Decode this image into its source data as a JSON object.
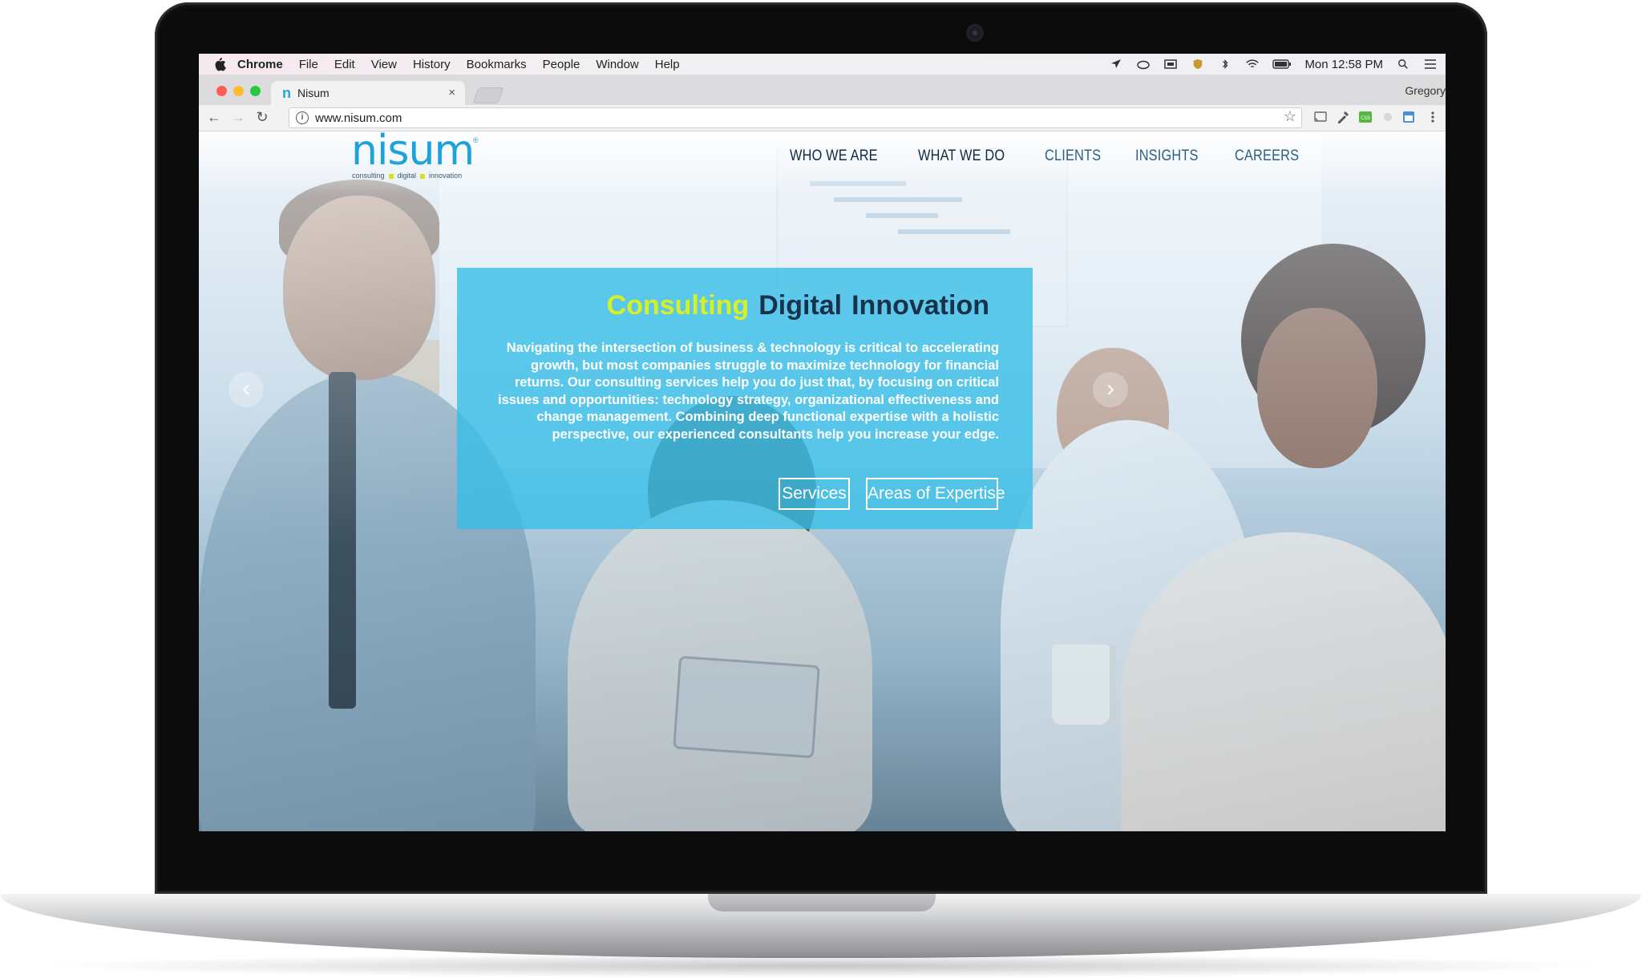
{
  "menubar": {
    "app": "Chrome",
    "items": [
      "File",
      "Edit",
      "View",
      "History",
      "Bookmarks",
      "People",
      "Window",
      "Help"
    ],
    "clock": "Mon 12:58 PM"
  },
  "browser": {
    "tab_title": "Nisum",
    "tab_favicon": "n",
    "tab_close": "×",
    "profile": "Gregory",
    "url": "www.nisum.com"
  },
  "site": {
    "logo_text": "nisum",
    "logo_reg": "®",
    "logo_tagline": [
      "consulting",
      "digital",
      "innovation"
    ],
    "nav": [
      "WHO WE ARE",
      "WHAT WE DO",
      "CLIENTS",
      "INSIGHTS",
      "CAREERS"
    ],
    "hero": {
      "title_1": "Consulting",
      "title_2": "Digital",
      "title_3": "Innovation",
      "body": "Navigating the intersection of business & technology is critical to accelerating growth, but most companies struggle to maximize technology for financial returns. Our consulting services help you do just that, by focusing on critical issues and opportunities: technology strategy, organizational effectiveness and change management. Combining deep functional expertise with a holistic perspective, our experienced consultants help you increase your edge.",
      "btn_services": "Services",
      "btn_areas": "Areas of Expertise"
    },
    "arrows": {
      "left": "‹",
      "right": "›"
    }
  },
  "colors": {
    "brand_blue": "#1ea3d8",
    "hero_bg": "#34bee8",
    "accent_lime": "#d6f027",
    "navy": "#17324a"
  }
}
